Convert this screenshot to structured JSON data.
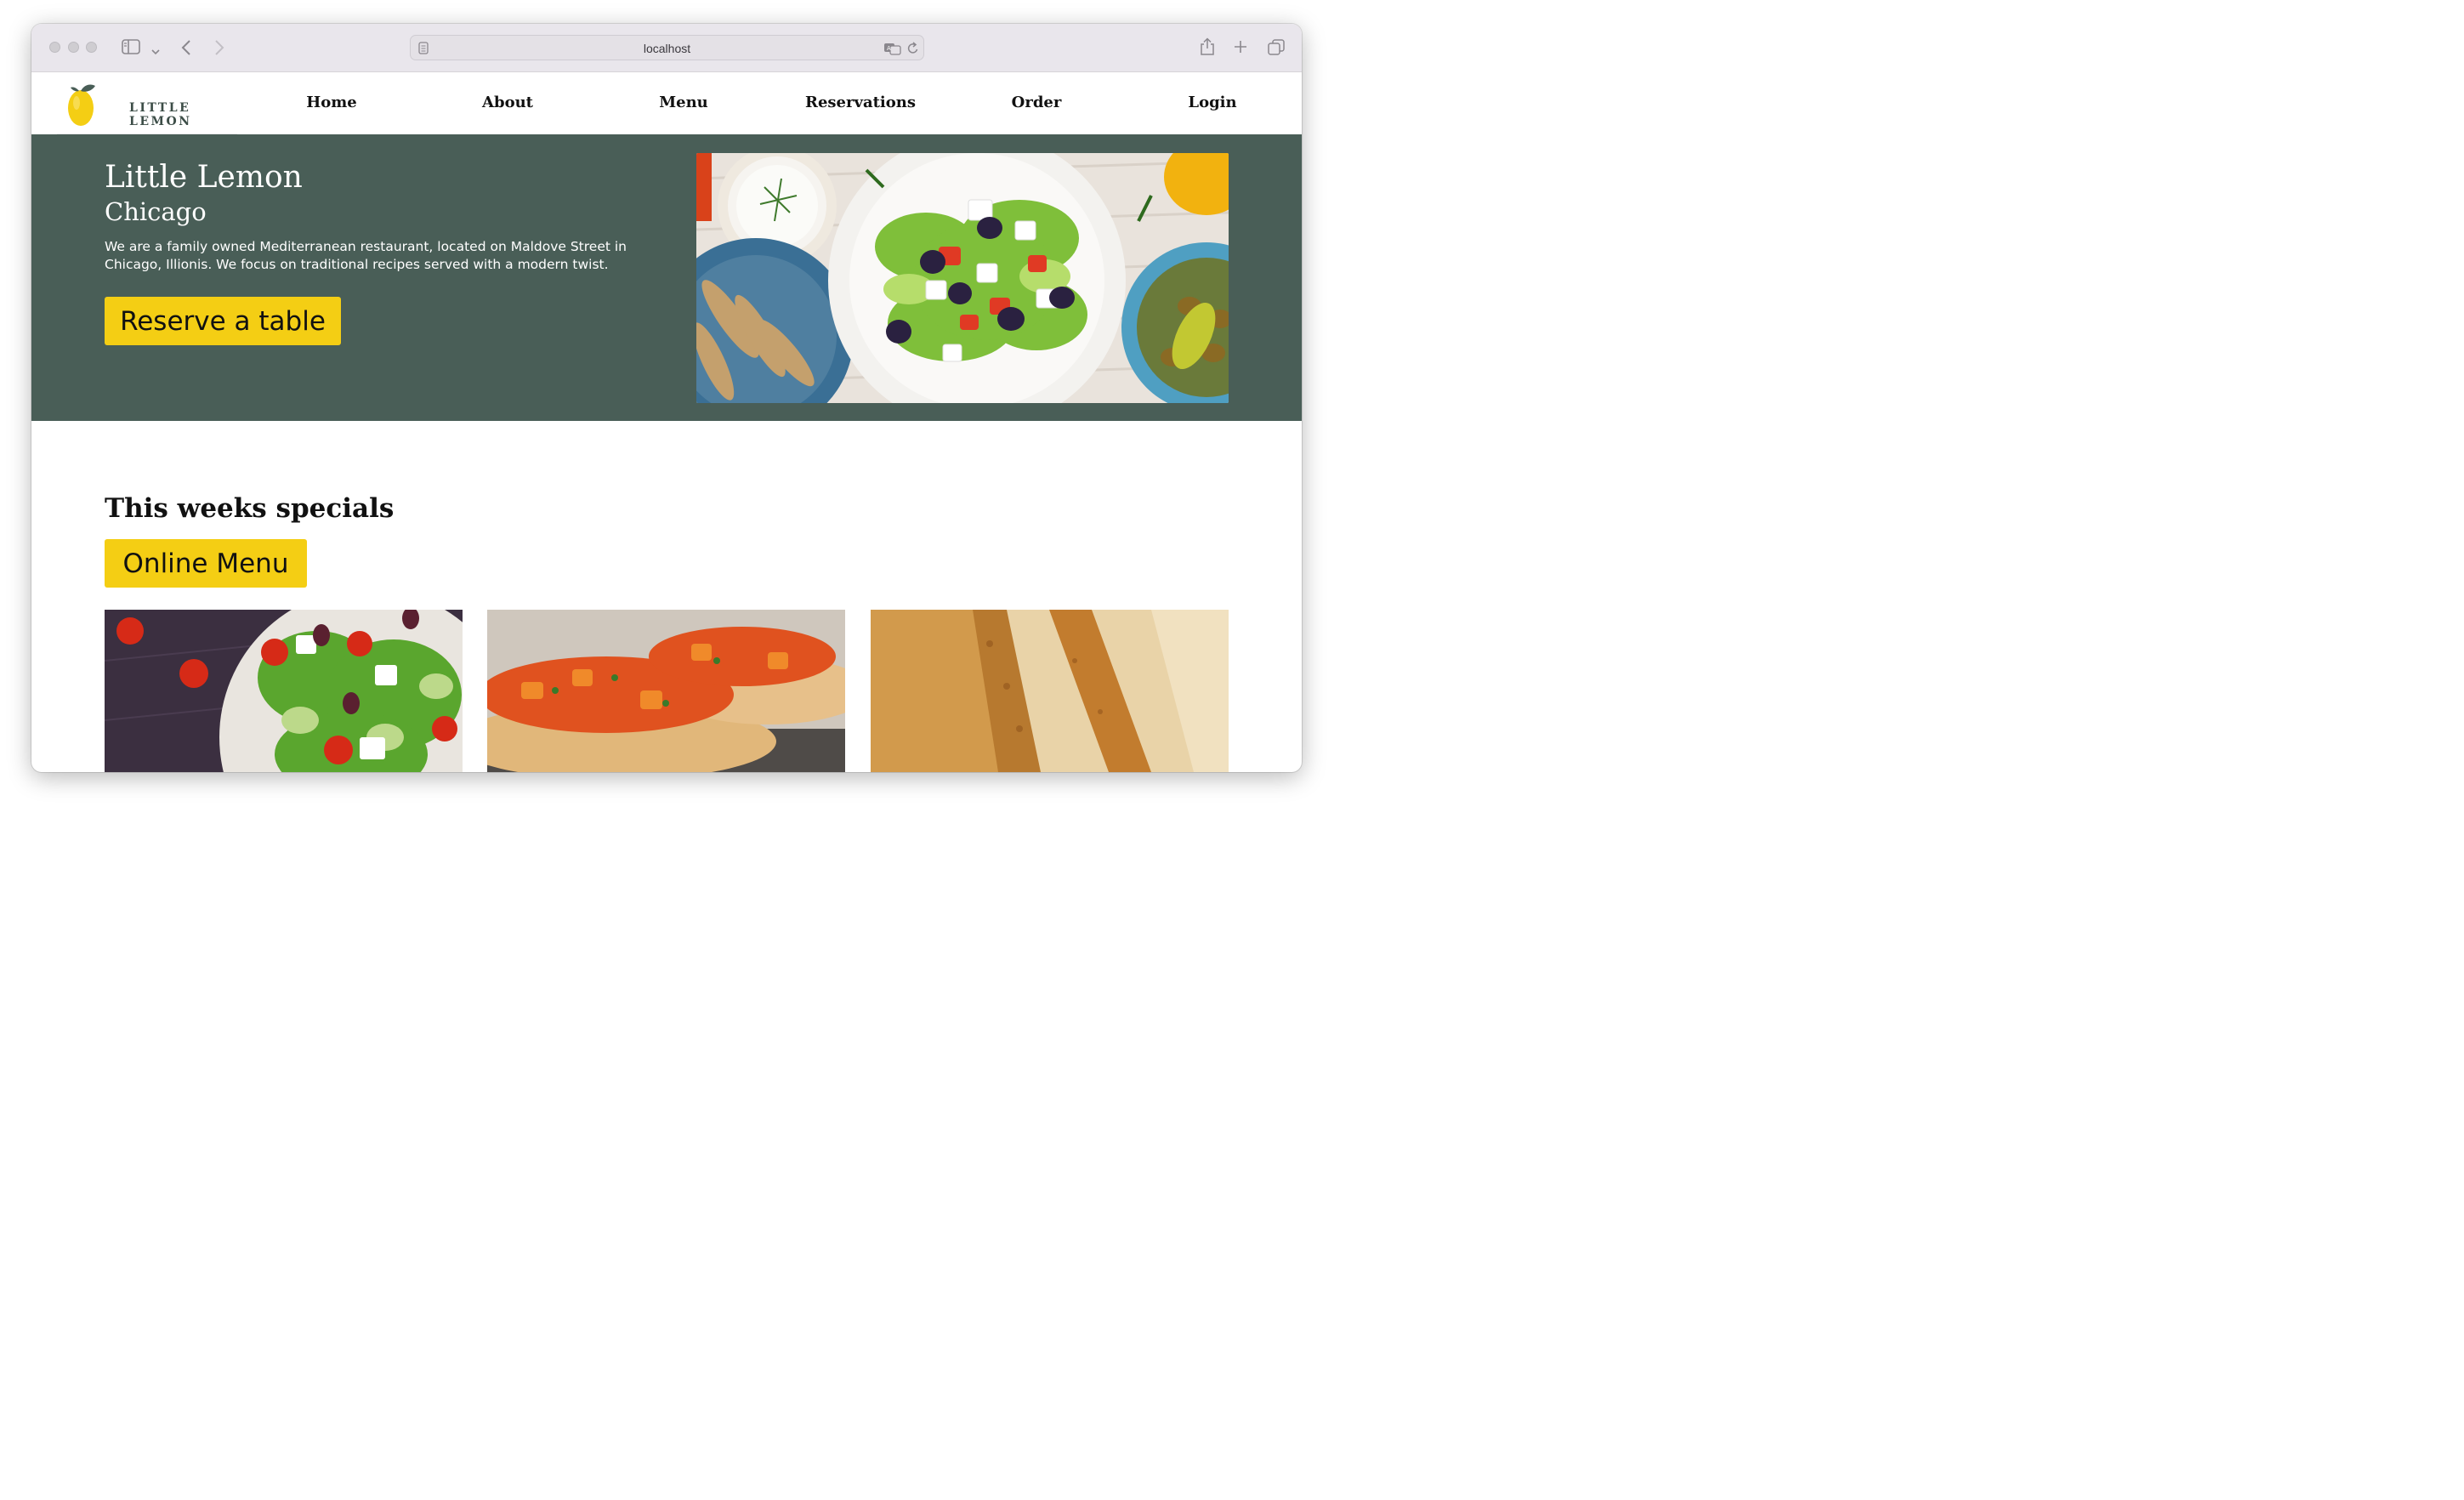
{
  "browser": {
    "address": "localhost",
    "icons": [
      "sidebar-icon",
      "chevron-down-icon",
      "back-arrow-icon",
      "forward-arrow-icon",
      "reader-icon",
      "translate-icon",
      "reload-icon",
      "share-icon",
      "new-tab-icon",
      "tabs-overview-icon"
    ]
  },
  "brand": {
    "logo_text": "LITTLE LEMON"
  },
  "nav": {
    "items": [
      {
        "label": "Home"
      },
      {
        "label": "About"
      },
      {
        "label": "Menu"
      },
      {
        "label": "Reservations"
      },
      {
        "label": "Order"
      },
      {
        "label": "Login"
      }
    ]
  },
  "hero": {
    "title": "Little Lemon",
    "subtitle": "Chicago",
    "description": "We are a family owned Mediterranean restaurant, located on Maldove Street in Chicago, Illionis. We focus on traditional recipes served with a modern twist.",
    "cta_label": "Reserve a table",
    "image_alt": "Mediterranean dishes: Greek salad, tzatziki, fried fish and olives"
  },
  "specials": {
    "title": "This weeks specials",
    "cta_label": "Online Menu",
    "cards": [
      {
        "image_alt": "Greek salad"
      },
      {
        "image_alt": "Bruschetta"
      },
      {
        "image_alt": "Lemon dessert"
      }
    ]
  },
  "colors": {
    "primary_green": "#495e57",
    "primary_yellow": "#f4ce14",
    "white": "#ffffff",
    "text_dark": "#111111"
  }
}
